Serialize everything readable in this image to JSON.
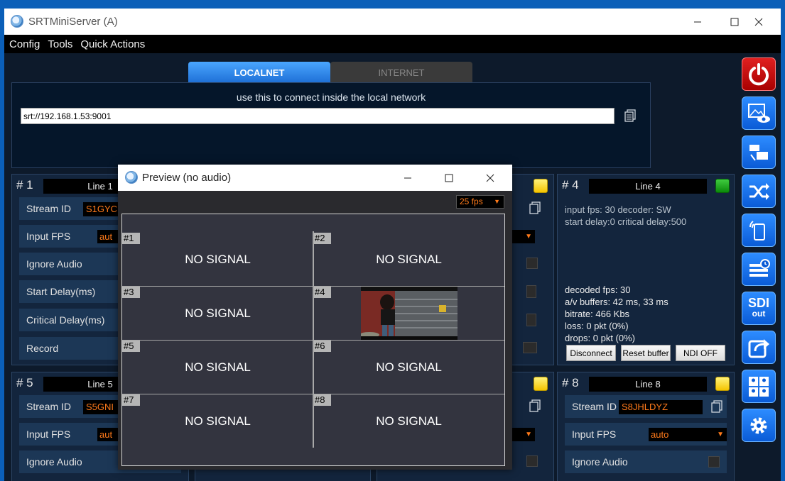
{
  "window": {
    "title": "SRTMiniServer (A)"
  },
  "menu": [
    "Config",
    "Tools",
    "Quick Actions"
  ],
  "tabs": {
    "localnet": "LOCALNET",
    "internet": "INTERNET"
  },
  "connect": {
    "hint": "use this to connect inside the local network",
    "url": "srt://192.168.1.53:9001"
  },
  "lines": {
    "line1": {
      "num": "# 1",
      "name": "Line 1",
      "stream_id_label": "Stream ID",
      "stream_id": "S1GYC",
      "input_fps_label": "Input FPS",
      "input_fps": "aut",
      "ignore_audio_label": "Ignore Audio",
      "start_delay_label": "Start Delay(ms)",
      "critical_delay_label": "Critical Delay(ms)",
      "record_label": "Record",
      "led": "yellow"
    },
    "line4": {
      "num": "# 4",
      "name": "Line 4",
      "led": "green",
      "input_info": "input fps: 30  decoder: SW",
      "delay_info": "start delay:0  critical delay:500",
      "stats": [
        "decoded fps: 30",
        "a/v buffers: 42 ms, 33 ms",
        "bitrate: 466 Kbs",
        "loss: 0 pkt (0%)",
        "drops: 0 pkt (0%)"
      ],
      "buttons": {
        "disconnect": "Disconnect",
        "reset": "Reset buffer",
        "ndi": "NDI OFF"
      }
    },
    "line5": {
      "num": "# 5",
      "name": "Line 5",
      "stream_id_label": "Stream ID",
      "stream_id": "S5GNI",
      "input_fps_label": "Input FPS",
      "input_fps": "aut",
      "ignore_audio_label": "Ignore Audio",
      "led": "yellow"
    },
    "line8": {
      "num": "# 8",
      "name": "Line 8",
      "stream_id_label": "Stream ID",
      "stream_id": "S8JHLDYZ",
      "input_fps_label": "Input FPS",
      "input_fps": "auto",
      "ignore_audio_label": "Ignore Audio",
      "led": "yellow"
    }
  },
  "toolbar": {
    "sdi_label": "SDI",
    "sdi_sub": "out",
    "icons": [
      "power-icon",
      "preview-eye-icon",
      "network-devices-icon",
      "shuffle-icon",
      "mobile-wifi-icon",
      "schedule-icon",
      "sdi-out-icon",
      "share-arrow-icon",
      "users-grid-icon",
      "gear-icon"
    ]
  },
  "preview": {
    "title": "Preview (no audio)",
    "fps": "25 fps",
    "cells": [
      {
        "tag": "#1",
        "text": "NO SIGNAL"
      },
      {
        "tag": "#2",
        "text": "NO SIGNAL"
      },
      {
        "tag": "#3",
        "text": "NO SIGNAL"
      },
      {
        "tag": "#4",
        "text": ""
      },
      {
        "tag": "#5",
        "text": "NO SIGNAL"
      },
      {
        "tag": "#6",
        "text": "NO SIGNAL"
      },
      {
        "tag": "#7",
        "text": "NO SIGNAL"
      },
      {
        "tag": "#8",
        "text": "NO SIGNAL"
      }
    ]
  },
  "colors": {
    "accent": "#1e6fd6",
    "panel": "#13253d",
    "value_orange": "#ff7a1a"
  }
}
